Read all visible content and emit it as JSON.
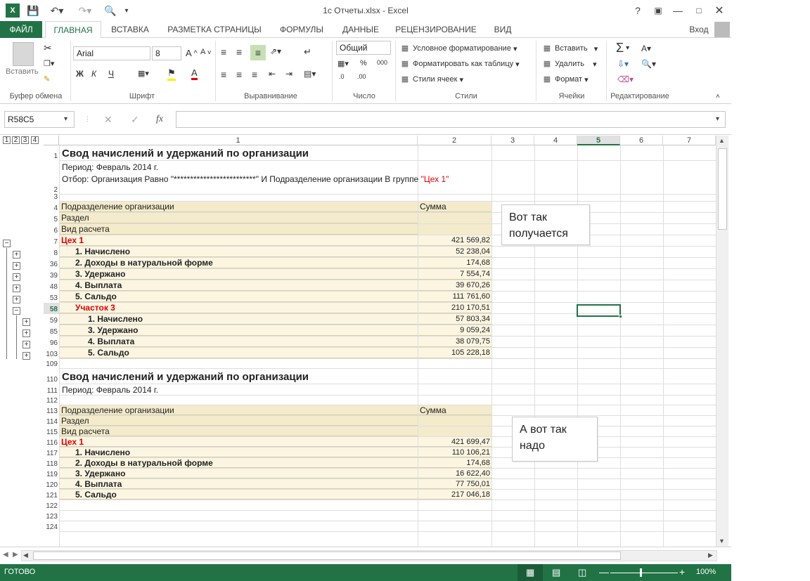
{
  "window": {
    "title": "1с Отчеты.xlsx - Excel",
    "help": "?",
    "sign_in": "Вход"
  },
  "ribbon_tabs": [
    "ФАЙЛ",
    "ГЛАВНАЯ",
    "ВСТАВКА",
    "РАЗМЕТКА СТРАНИЦЫ",
    "ФОРМУЛЫ",
    "ДАННЫЕ",
    "РЕЦЕНЗИРОВАНИЕ",
    "ВИД"
  ],
  "ribbon": {
    "paste": "Вставить",
    "clipboard": "Буфер обмена",
    "font_name": "Arial",
    "font_size": "8",
    "font": "Шрифт",
    "bold": "Ж",
    "italic": "К",
    "underline": "Ч",
    "alignment": "Выравнивание",
    "number_format": "Общий",
    "number": "Число",
    "cond_format": "Условное форматирование",
    "format_table": "Форматировать как таблицу",
    "cell_styles": "Стили ячеек",
    "styles": "Стили",
    "insert": "Вставить",
    "delete": "Удалить",
    "format": "Формат",
    "cells": "Ячейки",
    "editing": "Редактирование"
  },
  "formula_bar": {
    "name_box": "R58C5",
    "fx": "fx",
    "value": ""
  },
  "outline_levels": [
    "1",
    "2",
    "3",
    "4"
  ],
  "columns": [
    {
      "label": "1"
    },
    {
      "label": "2"
    },
    {
      "label": "3"
    },
    {
      "label": "4"
    },
    {
      "label": "5"
    },
    {
      "label": "6"
    },
    {
      "label": "7"
    }
  ],
  "rows": [
    {
      "n": "1",
      "a": "Свод начислений и удержаний по организации",
      "b": "",
      "style": "title"
    },
    {
      "n": "2",
      "a": "Период: Февраль 2014 г.",
      "a2": "Отбор: Организация Равно \"*************************\" И Подразделение организации В группе ",
      "a3": "\"Цех 1\"",
      "b": "",
      "style": "info"
    },
    {
      "n": "3",
      "a": "",
      "b": "",
      "style": "blank"
    },
    {
      "n": "4",
      "a": "Подразделение организации",
      "b": "Сумма",
      "style": "hdr"
    },
    {
      "n": "5",
      "a": "Раздел",
      "b": "",
      "style": "hdr"
    },
    {
      "n": "6",
      "a": "Вид расчета",
      "b": "",
      "style": "hdr"
    },
    {
      "n": "7",
      "a": "Цех 1",
      "b": "421 569,82",
      "style": "red"
    },
    {
      "n": "8",
      "a": "1. Начислено",
      "b": "52 238,04",
      "style": "lvl1"
    },
    {
      "n": "36",
      "a": "2. Доходы в натуральной форме",
      "b": "174,68",
      "style": "lvl1"
    },
    {
      "n": "39",
      "a": "3. Удержано",
      "b": "7 554,74",
      "style": "lvl1"
    },
    {
      "n": "48",
      "a": "4. Выплата",
      "b": "39 670,26",
      "style": "lvl1"
    },
    {
      "n": "53",
      "a": "5. Сальдо",
      "b": "111 761,60",
      "style": "lvl1"
    },
    {
      "n": "58",
      "a": "Участок 3",
      "b": "210 170,51",
      "style": "red2"
    },
    {
      "n": "59",
      "a": "1. Начислено",
      "b": "57 803,34",
      "style": "lvl2"
    },
    {
      "n": "85",
      "a": "3. Удержано",
      "b": "9 059,24",
      "style": "lvl2"
    },
    {
      "n": "96",
      "a": "4. Выплата",
      "b": "38 079,75",
      "style": "lvl2"
    },
    {
      "n": "103",
      "a": "5. Сальдо",
      "b": "105 228,18",
      "style": "lvl2"
    },
    {
      "n": "109",
      "a": "",
      "b": "",
      "style": "blank"
    },
    {
      "n": "110",
      "a": "Свод начислений и удержаний по организации",
      "b": "",
      "style": "title"
    },
    {
      "n": "111",
      "a": "Период: Февраль 2014 г.",
      "b": "",
      "style": "info1"
    },
    {
      "n": "112",
      "a": "",
      "b": "",
      "style": "blank"
    },
    {
      "n": "113",
      "a": "Подразделение организации",
      "b": "Сумма",
      "style": "hdr"
    },
    {
      "n": "114",
      "a": "Раздел",
      "b": "",
      "style": "hdr"
    },
    {
      "n": "115",
      "a": "Вид расчета",
      "b": "",
      "style": "hdr"
    },
    {
      "n": "116",
      "a": "Цех 1",
      "b": "421 699,47",
      "style": "red"
    },
    {
      "n": "117",
      "a": "1. Начислено",
      "b": "110 106,21",
      "style": "lvl1"
    },
    {
      "n": "118",
      "a": "2. Доходы в натуральной форме",
      "b": "174,68",
      "style": "lvl1"
    },
    {
      "n": "119",
      "a": "3. Удержано",
      "b": "16 622,40",
      "style": "lvl1"
    },
    {
      "n": "120",
      "a": "4. Выплата",
      "b": "77 750,01",
      "style": "lvl1"
    },
    {
      "n": "121",
      "a": "5. Сальдо",
      "b": "217 046,18",
      "style": "lvl1"
    },
    {
      "n": "122",
      "a": "",
      "b": "",
      "style": "blank"
    },
    {
      "n": "123",
      "a": "",
      "b": "",
      "style": "blank"
    },
    {
      "n": "124",
      "a": "",
      "b": "",
      "style": "blank"
    }
  ],
  "notes": {
    "note1": "Вот так получается",
    "note2": "А вот так надо"
  },
  "status": {
    "ready": "ГОТОВО",
    "zoom": "100%"
  },
  "colors": {
    "excel_green": "#217346",
    "red_text": "#e00000",
    "tan": "#f7efd6"
  }
}
